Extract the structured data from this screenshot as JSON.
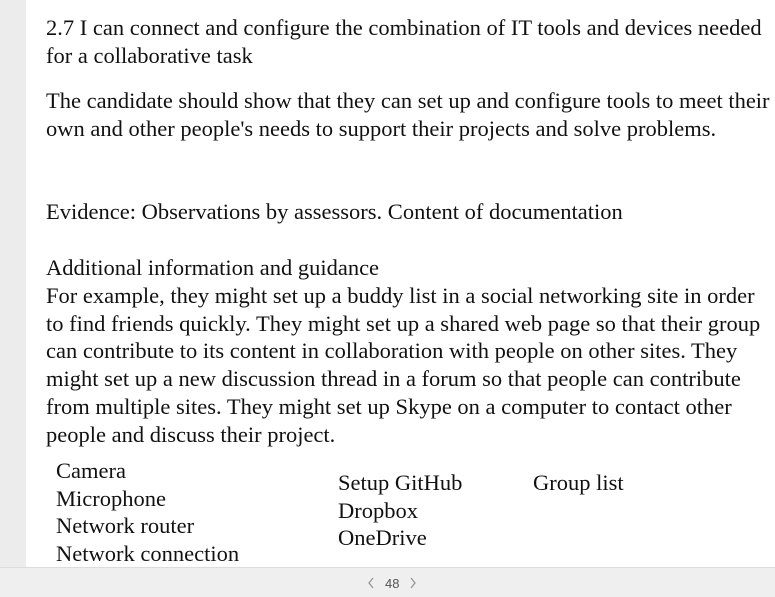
{
  "document": {
    "heading": "2.7 I can connect and configure the combination of IT tools and devices needed for a collaborative task",
    "paragraph1": "The candidate should show that they can set up and configure tools to meet their own and other people's needs to support their projects and solve problems.",
    "evidence": "Evidence: Observations by assessors. Content of documentation",
    "additional_title": "Additional information and guidance",
    "additional_body": "For example, they might set up a buddy list in a social networking site in order to find friends quickly. They might set up a shared web page so that their group can contribute to its content in collaboration with people on other sites. They might set up a new discussion thread in a forum so that people can contribute from multiple sites. They might set up Skype on a computer to contact other people and discuss their project."
  },
  "lists": {
    "column1": [
      "Camera",
      "Microphone",
      "Network router",
      "Network connection"
    ],
    "column2": [
      "Setup GitHub",
      "Dropbox",
      "OneDrive"
    ],
    "column3": [
      "Group list"
    ]
  },
  "pager": {
    "page_number": "48",
    "prev_icon": "chevron-left-icon",
    "next_icon": "chevron-right-icon"
  },
  "colors": {
    "page_background": "#ffffff",
    "viewer_background": "#ececec",
    "text": "#111111",
    "pager_text": "#555555"
  }
}
